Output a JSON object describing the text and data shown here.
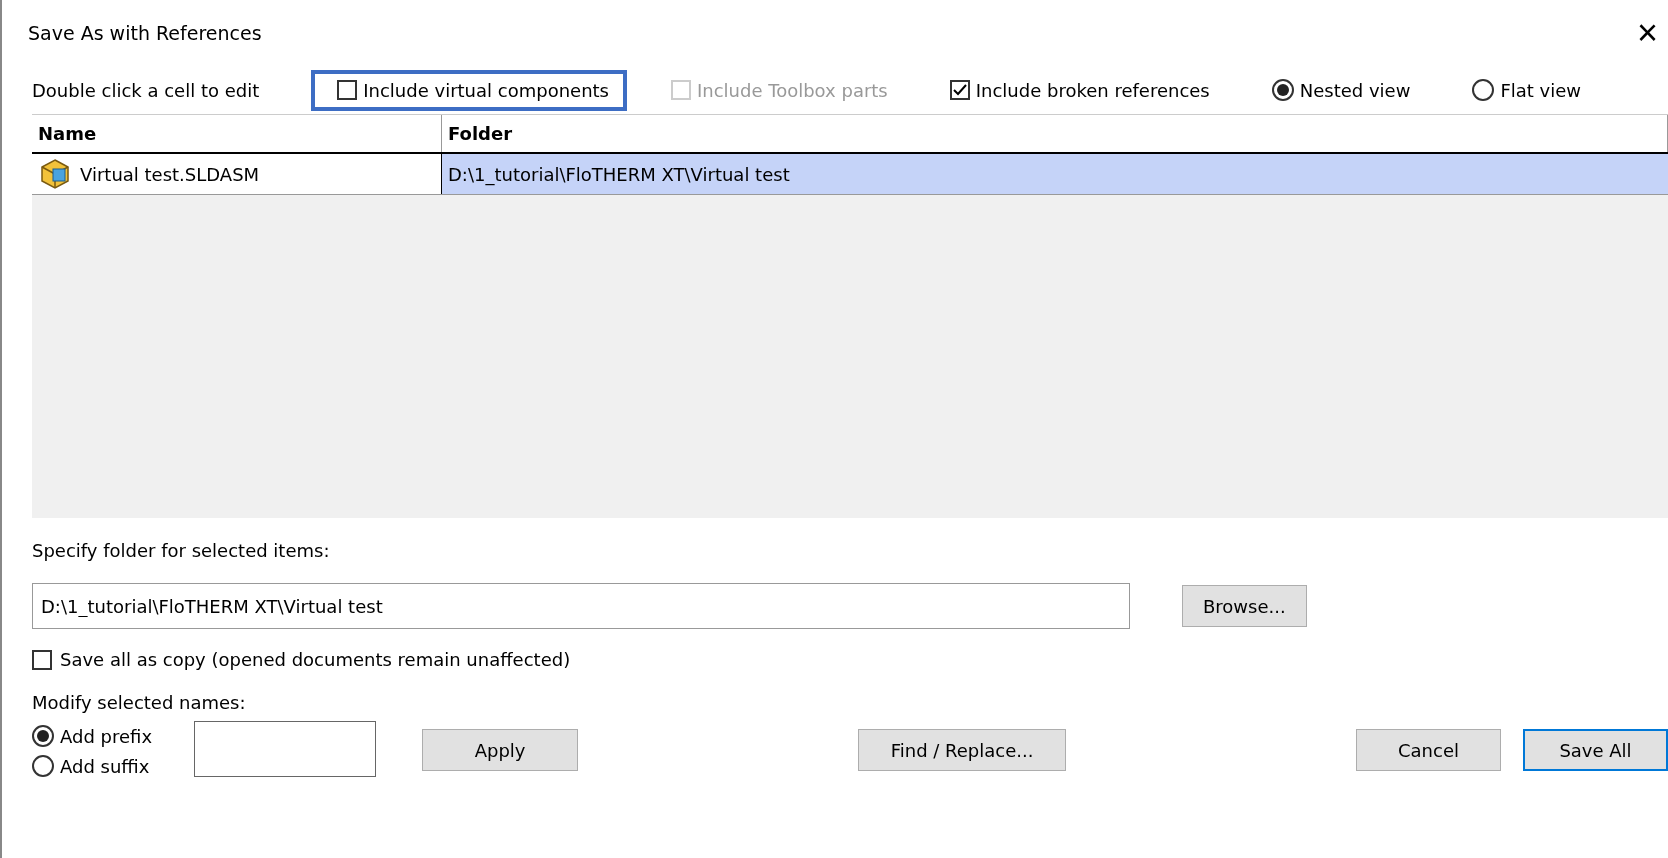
{
  "window": {
    "title": "Save As with References",
    "close": "×"
  },
  "hint": "Double click a cell to edit",
  "options": [
    {
      "kind": "checkbox",
      "label": "Include virtual components",
      "checked": false,
      "disabled": false,
      "highlighted": true
    },
    {
      "kind": "checkbox",
      "label": "Include Toolbox parts",
      "checked": false,
      "disabled": true,
      "highlighted": false
    },
    {
      "kind": "checkbox",
      "label": "Include broken references",
      "checked": true,
      "disabled": false,
      "highlighted": false
    },
    {
      "kind": "radio",
      "label": "Nested view",
      "selected": true,
      "disabled": false,
      "highlighted": false
    },
    {
      "kind": "radio",
      "label": "Flat view",
      "selected": false,
      "disabled": false,
      "highlighted": false
    }
  ],
  "table": {
    "columns": [
      "Name",
      "Folder"
    ],
    "rows": [
      {
        "name": "Virtual test.SLDASM",
        "folder": "D:\\1_tutorial\\FloTHERM XT\\Virtual test",
        "selected": true
      }
    ]
  },
  "folder": {
    "label": "Specify folder for selected items:",
    "value": "D:\\1_tutorial\\FloTHERM XT\\Virtual test",
    "browse": "Browse..."
  },
  "save_copy": {
    "label": "Save all as copy (opened documents remain unaffected)",
    "checked": false
  },
  "modify": {
    "label": "Modify selected names:",
    "choices": [
      {
        "label": "Add prefix",
        "selected": true
      },
      {
        "label": "Add suffix",
        "selected": false
      }
    ],
    "apply": "Apply",
    "find_replace": "Find / Replace..."
  },
  "buttons": [
    {
      "label": "Cancel",
      "default": false
    },
    {
      "label": "Save All",
      "default": true
    }
  ]
}
